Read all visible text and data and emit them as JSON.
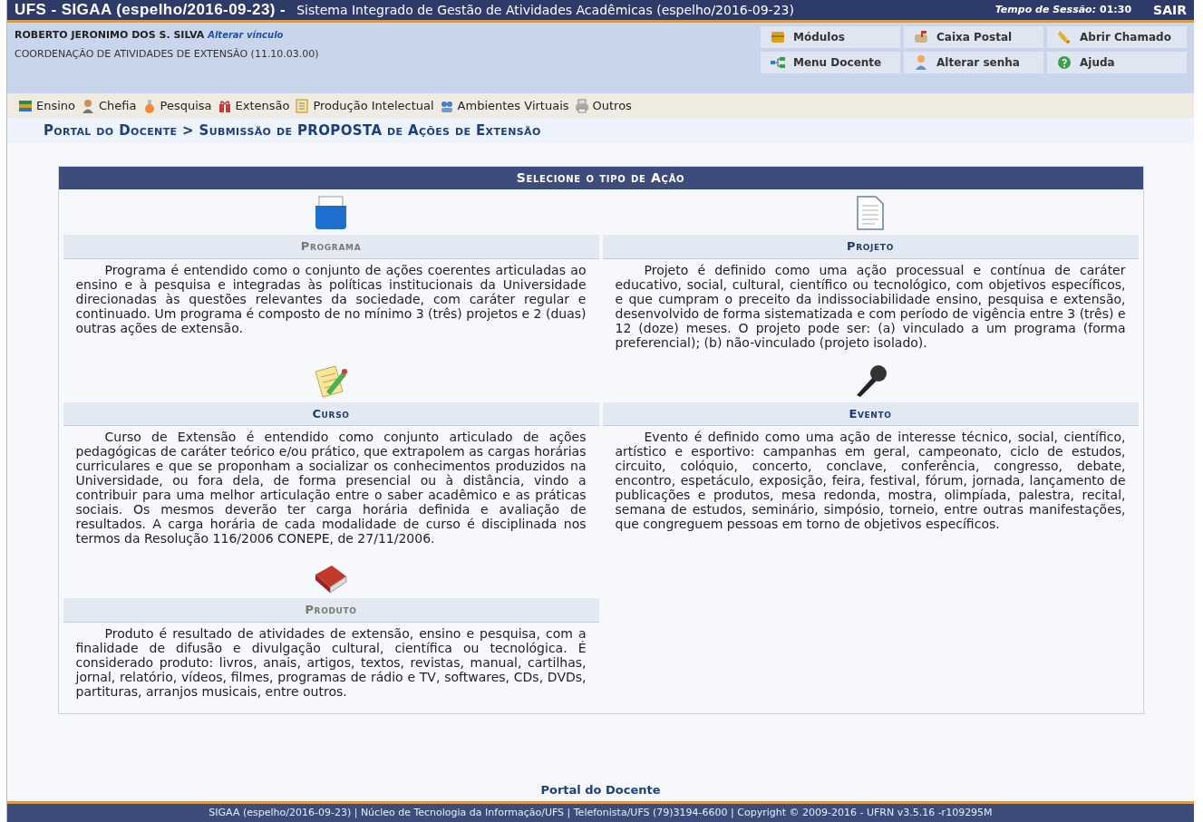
{
  "header": {
    "system": "UFS - SIGAA (espelho/2016-09-23) -",
    "subtitle": "Sistema Integrado de Gestão de Atividades Acadêmicas (espelho/2016-09-23)",
    "session_label": "Tempo de Sessão:",
    "session_time": "01:30",
    "logout": "SAIR"
  },
  "user": {
    "name": "ROBERTO JERONIMO DOS S. SILVA",
    "change_link": "Alterar vínculo",
    "unit": "COORDENAÇÃO DE ATIVIDADES DE EXTENSÃO (11.10.03.00)"
  },
  "shortcuts": [
    {
      "label": "Módulos"
    },
    {
      "label": "Caixa Postal"
    },
    {
      "label": "Abrir Chamado"
    },
    {
      "label": "Menu Docente"
    },
    {
      "label": "Alterar senha"
    },
    {
      "label": "Ajuda"
    }
  ],
  "menu": [
    {
      "label": "Ensino"
    },
    {
      "label": "Chefia"
    },
    {
      "label": "Pesquisa"
    },
    {
      "label": "Extensão"
    },
    {
      "label": "Produção Intelectual"
    },
    {
      "label": "Ambientes Virtuais"
    },
    {
      "label": "Outros"
    }
  ],
  "breadcrumb": "Portal do Docente > Submissão de PROPOSTA de Ações de Extensão",
  "panel": {
    "title": "Selecione o tipo de Ação",
    "actions": [
      {
        "title": "Programa",
        "disabled": true,
        "description": "Programa é entendido como o conjunto de ações coerentes articuladas ao ensino e à pesquisa e integradas às políticas institucionais da Universidade direcionadas às questões relevantes da sociedade, com caráter regular e continuado. Um programa é composto de no mínimo 3 (três) projetos e 2 (duas) outras ações de extensão."
      },
      {
        "title": "Projeto",
        "disabled": false,
        "description": "Projeto é definido como uma ação processual e contínua de caráter educativo, social, cultural, científico ou tecnológico, com objetivos específicos, e que cumpram o preceito da indissociabilidade ensino, pesquisa e extensão, desenvolvido de forma sistematizada e com período de vigência entre 3 (três) e 12 (doze) meses. O projeto pode ser: (a) vinculado a um programa (forma preferencial); (b) não-vinculado (projeto isolado)."
      },
      {
        "title": "Curso",
        "disabled": false,
        "description": "Curso de Extensão é entendido como conjunto articulado de ações pedagógicas de caráter teórico e/ou prático, que extrapolem as cargas horárias curriculares e que se proponham a socializar os conhecimentos produzidos na Universidade, ou fora dela, de forma presencial ou à distância, vindo a contribuir para uma melhor articulação entre o saber acadêmico e as práticas sociais. Os mesmos deverão ter carga horária definida e avaliação de resultados. A carga horária de cada modalidade de curso é disciplinada nos termos da Resolução 116/2006 CONEPE, de 27/11/2006."
      },
      {
        "title": "Evento",
        "disabled": false,
        "description": "Evento é definido como uma ação de interesse técnico, social, científico, artístico e esportivo: campanhas em geral, campeonato, ciclo de estudos, circuito, colóquio, concerto, conclave, conferência, congresso, debate, encontro, espetáculo, exposição, feira, festival, fórum, jornada, lançamento de publicações e produtos, mesa redonda, mostra, olimpíada, palestra, recital, semana de estudos, seminário, simpósio, torneio, entre outras manifestações, que congreguem pessoas em torno de objetivos específicos."
      },
      {
        "title": "Produto",
        "disabled": true,
        "description": "Produto é resultado de atividades de extensão, ensino e pesquisa, com a finalidade de difusão e divulgação cultural, científica ou tecnológica. É considerado produto: livros, anais, artigos, textos, revistas, manual, cartilhas, jornal, relatório, vídeos, filmes, programas de rádio e TV, softwares, CDs, DVDs, partituras, arranjos musicais, entre outros."
      }
    ]
  },
  "footer": {
    "link": "Portal do Docente",
    "text": "SIGAA (espelho/2016-09-23) | Núcleo de Tecnologia da Informação/UFS | Telefonista/UFS (79)3194-6600 | Copyright © 2009-2016 - UFRN v3.5.16 -r109295M"
  }
}
